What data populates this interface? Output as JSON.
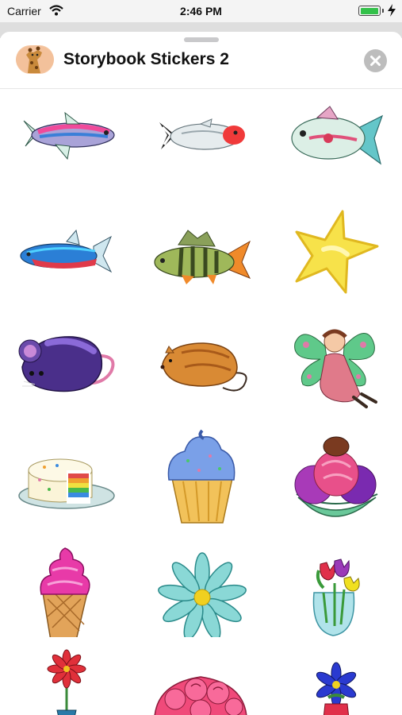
{
  "status_bar": {
    "carrier": "Carrier",
    "time": "2:46 PM",
    "battery_level": 1.0,
    "battery_color": "#33c14a"
  },
  "header": {
    "title": "Storybook Stickers 2",
    "app_icon": "giraffe-icon",
    "close_icon": "close-icon"
  },
  "stickers": [
    "neon-tetra-fish",
    "red-nose-fish",
    "glass-tetra-fish",
    "blue-tetra-fish",
    "perch-fish",
    "yellow-star",
    "purple-mouse",
    "orange-hamster",
    "green-winged-fairy",
    "rainbow-cake",
    "blue-frosted-cupcake",
    "ice-cream-sundae",
    "pink-soft-serve-cone",
    "teal-daisy",
    "tulips-in-vase",
    "red-flower-pot",
    "pink-roses-bouquet",
    "blue-flower-pot"
  ]
}
